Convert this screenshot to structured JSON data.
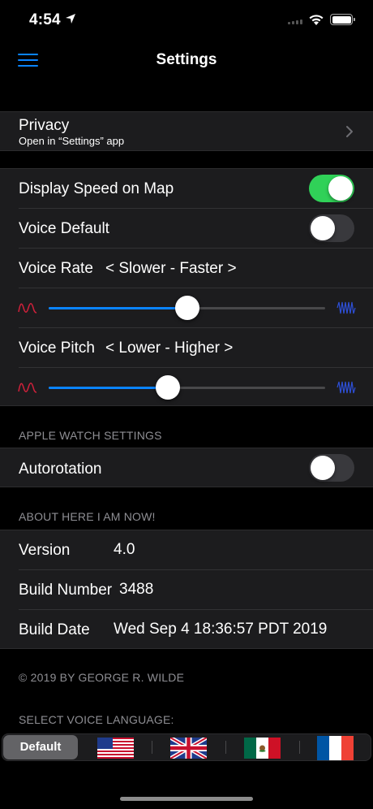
{
  "status": {
    "time": "4:54"
  },
  "nav": {
    "title": "Settings"
  },
  "privacy": {
    "label": "Privacy",
    "sublabel": "Open in “Settings” app"
  },
  "voice": {
    "display_speed_label": "Display Speed on Map",
    "display_speed_on": true,
    "voice_default_label": "Voice Default",
    "voice_default_on": false,
    "rate_label": "Voice Rate",
    "rate_hint": "< Slower - Faster >",
    "rate_value": 0.5,
    "pitch_label": "Voice Pitch",
    "pitch_hint": "< Lower - Higher >",
    "pitch_value": 0.43
  },
  "watch": {
    "header": "APPLE WATCH SETTINGS",
    "autorotation_label": "Autorotation",
    "autorotation_on": false
  },
  "about": {
    "header": "ABOUT HERE I AM NOW!",
    "version_label": "Version",
    "version_value": "4.0",
    "build_number_label": "Build Number",
    "build_number_value": "3488",
    "build_date_label": "Build Date",
    "build_date_value": "Wed Sep 4 18:36:57 PDT 2019"
  },
  "copyright": "© 2019 BY GEORGE R. WILDE",
  "language": {
    "header": "SELECT VOICE LANGUAGE:",
    "default_label": "Default",
    "flags": [
      "us-flag-icon",
      "uk-flag-icon",
      "mexico-flag-icon",
      "france-flag-icon"
    ]
  },
  "colors": {
    "accent": "#0a84ff",
    "toggle_on": "#30d158",
    "wave_low": "#d0213b",
    "wave_high": "#2d4fd6"
  }
}
